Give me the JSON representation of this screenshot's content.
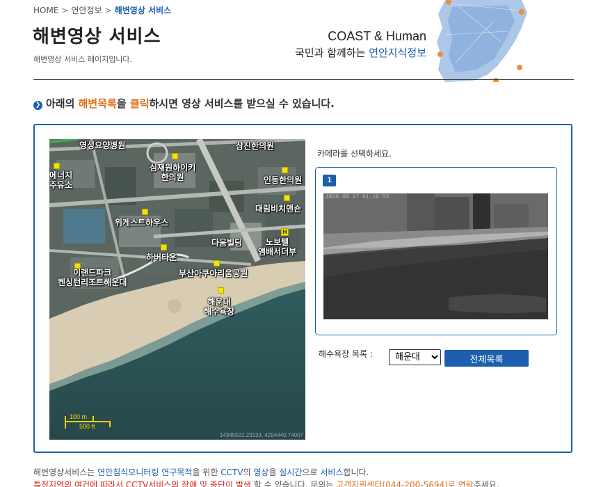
{
  "breadcrumb": {
    "home": "HOME",
    "separator": ">",
    "level1": "연안정보",
    "current": "해변영상 서비스"
  },
  "header": {
    "title": "해변영상 서비스",
    "subtitle": "해변영상 서비스 페이지입니다.",
    "brand_en": "COAST & Human",
    "brand_ko_prefix": "국민과 함께하는 ",
    "brand_ko_highlight": "연안지식정보"
  },
  "instruction": {
    "p1": "아래의 ",
    "p2": "해변목록",
    "p3": "을 ",
    "p4": "클릭",
    "p5": "하시면 영상 서비스를 받으실 수 있습니다."
  },
  "map": {
    "labels": {
      "hospital": "영성요양병원",
      "samjin": "삼진한의원",
      "energy1": "에너지",
      "energy2": "주유소",
      "simjae1": "심재원하이키",
      "simjae2": "한의원",
      "indong": "인동한의원",
      "daerim": "대림비치맨숀",
      "weguest": "위게스트하우스",
      "noboetel1": "노보텔",
      "noboetel2": "앰배서더부",
      "daum": "다움빌딩",
      "harbor": "하버타운",
      "aquarium": "부산아쿠아리움공원",
      "iland1": "이랜드파크",
      "iland2": "켄싱턴리조트해운대",
      "beach1": "해운대",
      "beach2": "해수욕장"
    },
    "scale_m": "100 m",
    "scale_ft": "500 ft",
    "coords": "14345522.23133, 4294440.74007"
  },
  "camera": {
    "prompt": "카메라를 선택하세요.",
    "number": "1",
    "timestamp": "2020.08.17 01:16:53"
  },
  "controls": {
    "beach_list_label": "해수욕장 목록 :",
    "selected_beach": "해운대",
    "full_list_label": "전체목록"
  },
  "footer": {
    "n1_a": "해변영상서비스는 ",
    "n1_b": "연안침식모니터링 연구목적",
    "n1_c": "을 위한 ",
    "n1_d": "CCTV",
    "n1_e": "의 ",
    "n1_f": "영상",
    "n1_g": "을 ",
    "n1_h": "실시간",
    "n1_i": "으로 ",
    "n1_j": "서비스",
    "n1_k": "합니다.",
    "n2_a": "특정지역의 여건에 따라서 CCTV서비스의 장애 및 중단이 발생",
    "n2_b": " 할 수 있습니다. 문의는 ",
    "n2_c": "고객지원센터(044-200-5694)로 연락",
    "n2_d": "주세요."
  },
  "colors": {
    "brand_blue": "#1b5fae",
    "accent_orange": "#e0701c",
    "warning_red": "#d7261e"
  }
}
